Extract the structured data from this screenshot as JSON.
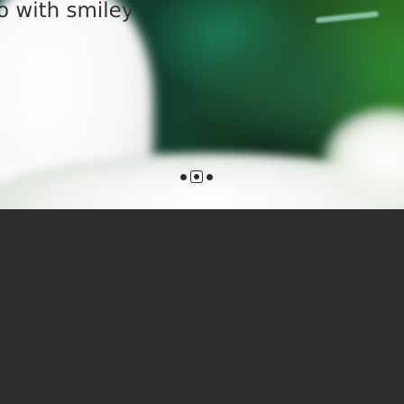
{
  "slide": {
    "caption": "o with smiley"
  },
  "pagination": {
    "dot_count": 3,
    "current_index": 2
  },
  "colors": {
    "background_dark": "#2c2c2c",
    "caption_text": "#333333",
    "dot": "#2b2b2b"
  }
}
